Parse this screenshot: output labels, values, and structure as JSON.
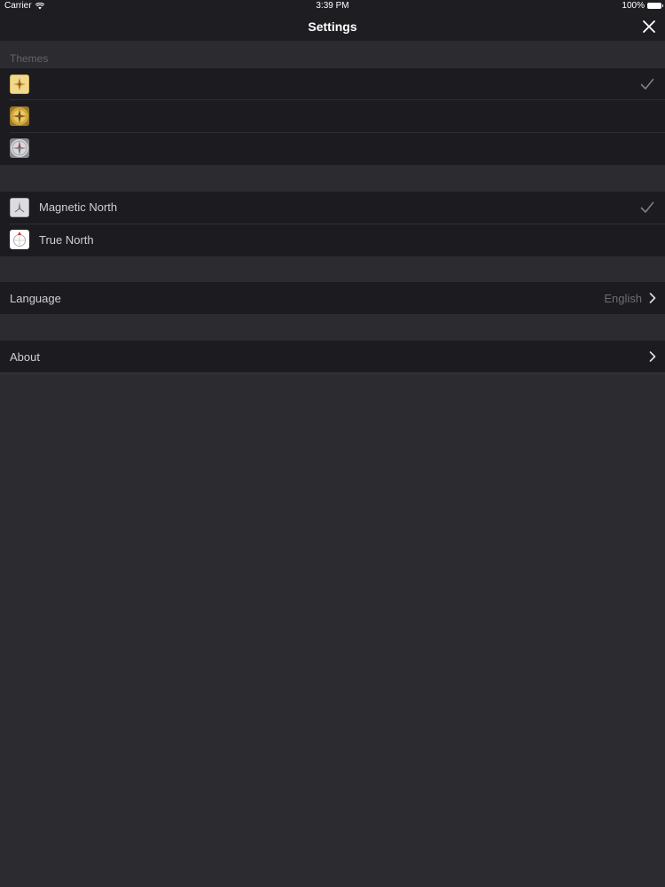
{
  "status_bar": {
    "carrier": "Carrier",
    "time": "3:39 PM",
    "battery": "100%"
  },
  "nav": {
    "title": "Settings"
  },
  "themes": {
    "header": "Themes",
    "items": [
      {
        "icon": "gold-compass-theme-icon",
        "selected": true
      },
      {
        "icon": "brass-compass-theme-icon",
        "selected": false
      },
      {
        "icon": "silver-compass-theme-icon",
        "selected": false
      }
    ]
  },
  "north": {
    "items": [
      {
        "label": "Magnetic North",
        "icon": "magnetic-north-icon",
        "selected": true
      },
      {
        "label": "True North",
        "icon": "true-north-icon",
        "selected": false
      }
    ]
  },
  "language": {
    "label": "Language",
    "value": "English"
  },
  "about": {
    "label": "About"
  },
  "colors": {
    "background": "#2b2b30",
    "row": "#1c1c20",
    "bar": "#1e1e22",
    "text": "#cfcfd3",
    "secondary": "#6c6c72"
  }
}
